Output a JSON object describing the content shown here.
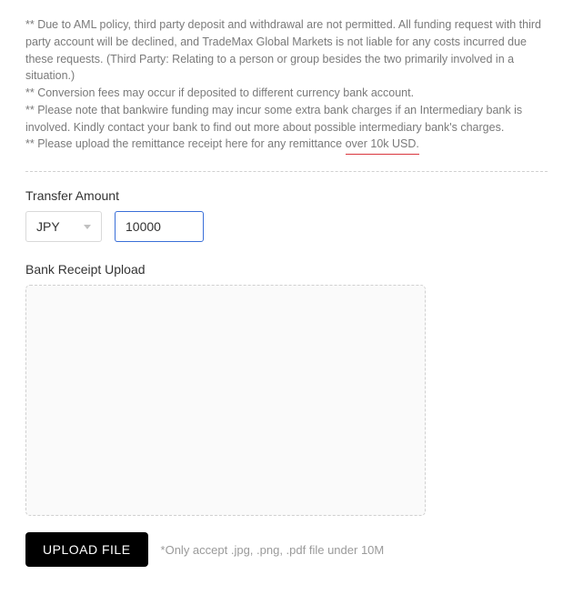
{
  "notice": {
    "line1": "** Due to AML policy, third party deposit and withdrawal are not permitted. All funding request with third party account will be declined, and TradeMax Global Markets is not liable for any costs incurred due these requests. (Third Party: Relating to a person or group besides the two primarily involved in a situation.)",
    "line2": "** Conversion fees may occur if deposited to different currency bank account.",
    "line3": "** Please note that bankwire funding may incur some extra bank charges if an Intermediary bank is involved. Kindly contact your bank to find out more about possible intermediary bank's charges.",
    "line4_prefix": "** Please upload the remittance receipt here for any remittance ",
    "line4_underlined": "over 10k USD."
  },
  "transfer": {
    "label": "Transfer Amount",
    "currency": "JPY",
    "amount": "10000"
  },
  "receipt": {
    "label": "Bank Receipt Upload"
  },
  "upload": {
    "button_label": "UPLOAD FILE",
    "accept_note": "*Only accept .jpg, .png, .pdf file under 10M"
  }
}
